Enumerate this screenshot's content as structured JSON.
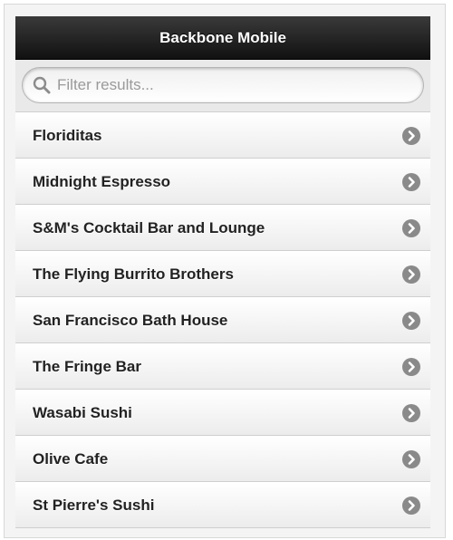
{
  "header": {
    "title": "Backbone Mobile"
  },
  "search": {
    "placeholder": "Filter results...",
    "value": "",
    "icon": "search-icon"
  },
  "list": {
    "chevron_icon": "chevron-right-circle-icon",
    "items": [
      {
        "label": "Floriditas"
      },
      {
        "label": "Midnight Espresso"
      },
      {
        "label": "S&M's Cocktail Bar and Lounge"
      },
      {
        "label": "The Flying Burrito Brothers"
      },
      {
        "label": "San Francisco Bath House"
      },
      {
        "label": "The Fringe Bar"
      },
      {
        "label": "Wasabi Sushi"
      },
      {
        "label": "Olive Cafe"
      },
      {
        "label": "St Pierre's Sushi"
      }
    ]
  },
  "colors": {
    "header_bg": "#1a1a1a",
    "header_text": "#ffffff",
    "chevron_bg": "#8a8a8a"
  }
}
